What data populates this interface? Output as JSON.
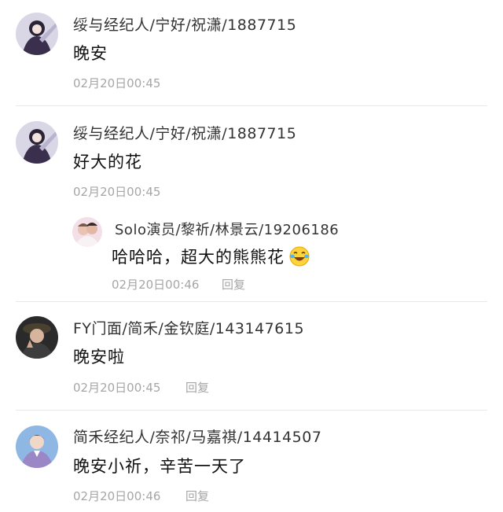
{
  "comments": [
    {
      "username": "绥与经纪人/宁好/祝潇/1887715",
      "text": "晚安",
      "timestamp": "02月20日00:45"
    },
    {
      "username": "绥与经纪人/宁好/祝潇/1887715",
      "text": "好大的花",
      "timestamp": "02月20日00:45",
      "reply": {
        "username": "Solo演员/黎祈/林景云/19206186",
        "text": "哈哈哈，超大的熊熊花",
        "emoji": "laughing-crying-emoji",
        "timestamp": "02月20日00:46",
        "reply_label": "回复"
      }
    },
    {
      "username": "FY门面/简禾/金钦庭/143147615",
      "text": "晚安啦",
      "timestamp": "02月20日00:45",
      "reply_label": "回复"
    },
    {
      "username": "简禾经纪人/奈祁/马嘉祺/14414507",
      "text": "晚安小祈，辛苦一天了",
      "timestamp": "02月20日00:46",
      "reply_label": "回复"
    }
  ],
  "colors": {
    "username": "#333333",
    "text": "#111111",
    "meta": "#a6a6a6",
    "divider": "#e8e8e8"
  }
}
